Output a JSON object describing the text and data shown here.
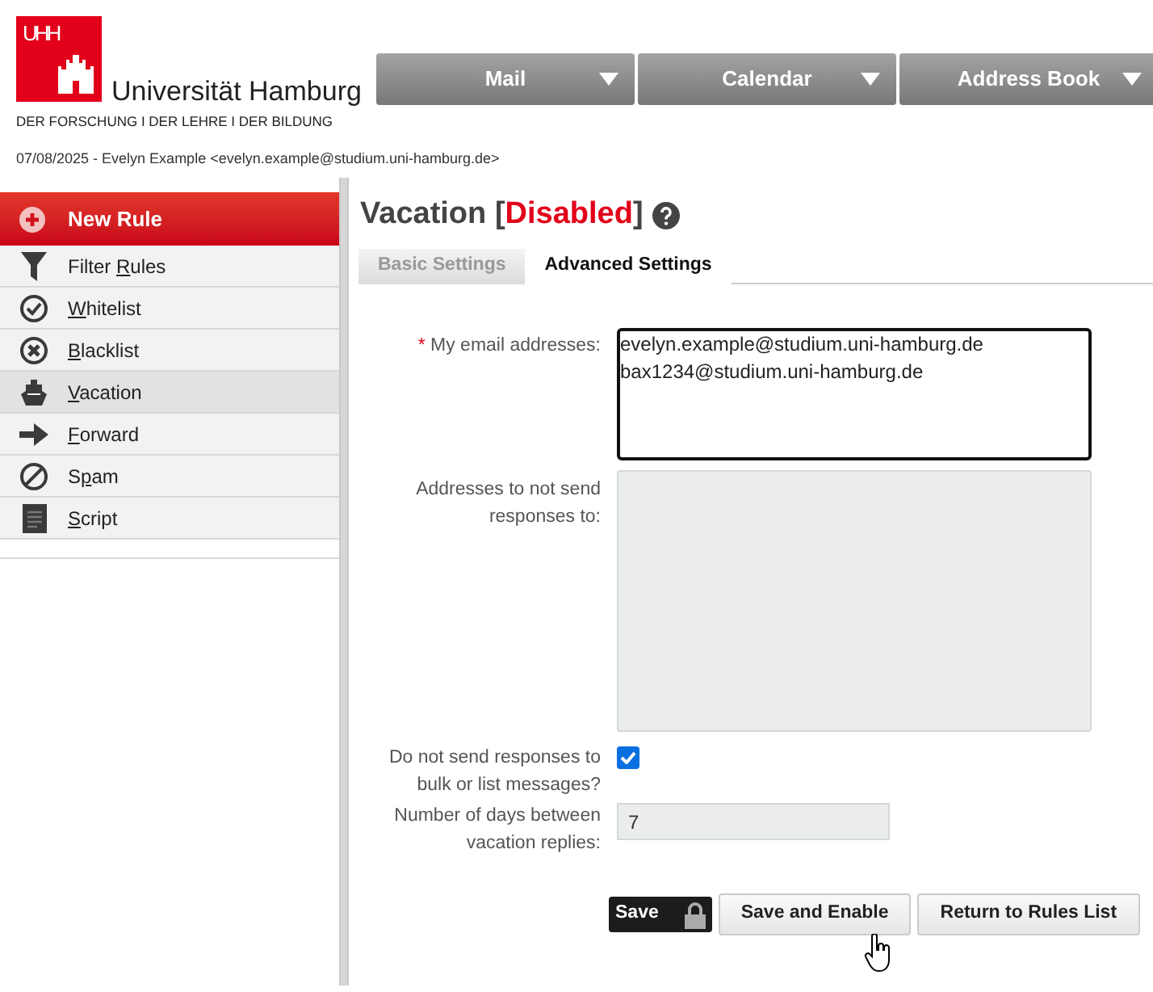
{
  "logo": {
    "mark": "UHH",
    "name": "Universität Hamburg",
    "tagline": "DER FORSCHUNG I DER LEHRE I DER BILDUNG"
  },
  "nav": [
    {
      "label": "Mail"
    },
    {
      "label": "Calendar"
    },
    {
      "label": "Address Book"
    }
  ],
  "user_line": "07/08/2025 - Evelyn Example <evelyn.example@studium.uni-hamburg.de>",
  "sidebar": {
    "new_rule": "New Rule",
    "items": [
      {
        "kind": "filter",
        "pre": "Filter ",
        "key": "R",
        "post": "ules",
        "selected": false
      },
      {
        "kind": "whitelist",
        "key": "W",
        "post": "hitelist",
        "selected": false
      },
      {
        "kind": "blacklist",
        "key": "B",
        "post": "lacklist",
        "selected": false
      },
      {
        "kind": "vacation",
        "key": "V",
        "post": "acation",
        "selected": true
      },
      {
        "kind": "forward",
        "key": "F",
        "post": "orward",
        "selected": false
      },
      {
        "kind": "spam",
        "pre": "S",
        "key": "p",
        "post": "am",
        "selected": false
      },
      {
        "kind": "script",
        "key": "S",
        "post": "cript",
        "selected": false
      }
    ]
  },
  "title": {
    "name": "Vacation",
    "open_bracket": "[",
    "status": "Disabled",
    "close_bracket": "]"
  },
  "tabs": [
    {
      "label": "Basic Settings",
      "selected": false
    },
    {
      "label": "Advanced Settings",
      "selected": true
    }
  ],
  "form": {
    "email_label": "My email addresses:",
    "required_mark": "*",
    "emails": [
      "evelyn.example@studium.uni-hamburg.de",
      "bax1234@studium.uni-hamburg.de"
    ],
    "exclude_label": "Addresses to not send responses to:",
    "bulk_label": "Do not send responses to bulk or list messages?",
    "bulk_checked": true,
    "days_label": "Number of days between vacation replies:",
    "days_value": "7"
  },
  "buttons": {
    "save": "Save",
    "save_enable": "Save and Enable",
    "return": "Return to Rules List"
  }
}
